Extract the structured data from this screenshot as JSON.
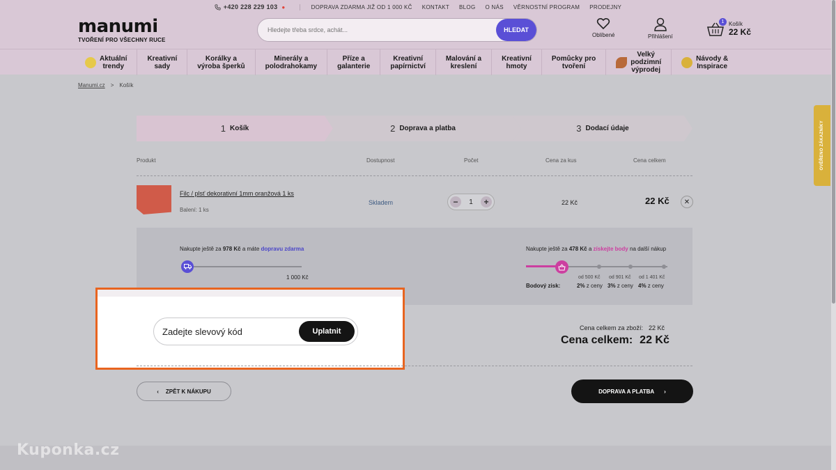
{
  "topbar": {
    "phone": "+420 228 229 103",
    "links": [
      "DOPRAVA ZDARMA JIŽ OD 1 000 KČ",
      "KONTAKT",
      "BLOG",
      "O NÁS",
      "VĚRNOSTNÍ PROGRAM",
      "PRODEJNY"
    ]
  },
  "header": {
    "logo": "manumi",
    "tagline": "TVOŘENÍ PRO VŠECHNY RUCE",
    "search_placeholder": "Hledejte třeba srdce, achát...",
    "search_button": "HLEDAT",
    "favorites": "Oblíbené",
    "login": "Přihlášení",
    "cart_label": "Košík",
    "cart_total": "22 Kč",
    "cart_count": "1"
  },
  "nav": [
    {
      "label": "Aktuální\ntrendy",
      "icon": "star-icon",
      "icon_color": "#e6c94a"
    },
    {
      "label": "Kreativní\nsady"
    },
    {
      "label": "Korálky a\nvýroba šperků"
    },
    {
      "label": "Minerály a\npolodrahokamy"
    },
    {
      "label": "Příze a\ngalanterie"
    },
    {
      "label": "Kreativní\npapírnictví"
    },
    {
      "label": "Malování a\nkreslení"
    },
    {
      "label": "Kreativní\nhmoty"
    },
    {
      "label": "Pomůcky pro\ntvoření"
    },
    {
      "label": "Velký\npodzimní\nvýprodej",
      "icon": "leaf-icon",
      "icon_color": "#b86a3a"
    },
    {
      "label": "Návody &\nInspirace",
      "icon": "bulb-icon",
      "icon_color": "#d9b13b"
    }
  ],
  "breadcrumb": {
    "home": "Manumi.cz",
    "separator": ">",
    "current": "Košík"
  },
  "steps": [
    {
      "num": "1",
      "label": "Košík"
    },
    {
      "num": "2",
      "label": "Doprava a platba"
    },
    {
      "num": "3",
      "label": "Dodací údaje"
    }
  ],
  "table": {
    "headers": {
      "product": "Produkt",
      "availability": "Dostupnost",
      "count": "Počet",
      "unit_price": "Cena za kus",
      "total_price": "Cena celkem"
    }
  },
  "item": {
    "name": "Filc / plsť dekorativní 1mm oranžová 1 ks",
    "pack": "Balení: 1 ks",
    "availability": "Skladem",
    "qty": "1",
    "unit_price": "22 Kč",
    "total": "22 Kč",
    "image_color": "#d05b49"
  },
  "shipping": {
    "pre": "Nakupte ještě za ",
    "amount": "978 Kč",
    "mid": " a máte ",
    "link": "dopravu zdarma",
    "goal": "1 000 Kč",
    "progress": 0.022
  },
  "points": {
    "pre": "Nakupte ještě za ",
    "amount": "478 Kč",
    "mid": " a ",
    "link": "získejte body",
    "post": " na další nákup",
    "label": "Bodový zisk:",
    "tiers": [
      {
        "from": "od 500 Kč",
        "pct": "2%",
        "suffix": " z ceny"
      },
      {
        "from": "od 901 Kč",
        "pct": "3%",
        "suffix": " z ceny"
      },
      {
        "from": "od 1 401 Kč",
        "pct": "4%",
        "suffix": " z ceny"
      }
    ]
  },
  "coupon": {
    "placeholder": "Zadejte slevový kód",
    "button": "Uplatnit"
  },
  "summary": {
    "goods_label": "Cena celkem za zboží:",
    "goods_value": "22 Kč",
    "total_label": "Cena celkem:",
    "total_value": "22 Kč"
  },
  "buttons": {
    "back": "ZPĚT K NÁKUPU",
    "next": "DOPRAVA A PLATBA"
  },
  "verified_badge": "OVĚŘENO ZÁKAZNÍKY",
  "watermark": "Kuponka.cz",
  "colors": {
    "accent": "#5a4fd6",
    "pink": "#cc3fa0",
    "highlight": "#e8641f"
  }
}
